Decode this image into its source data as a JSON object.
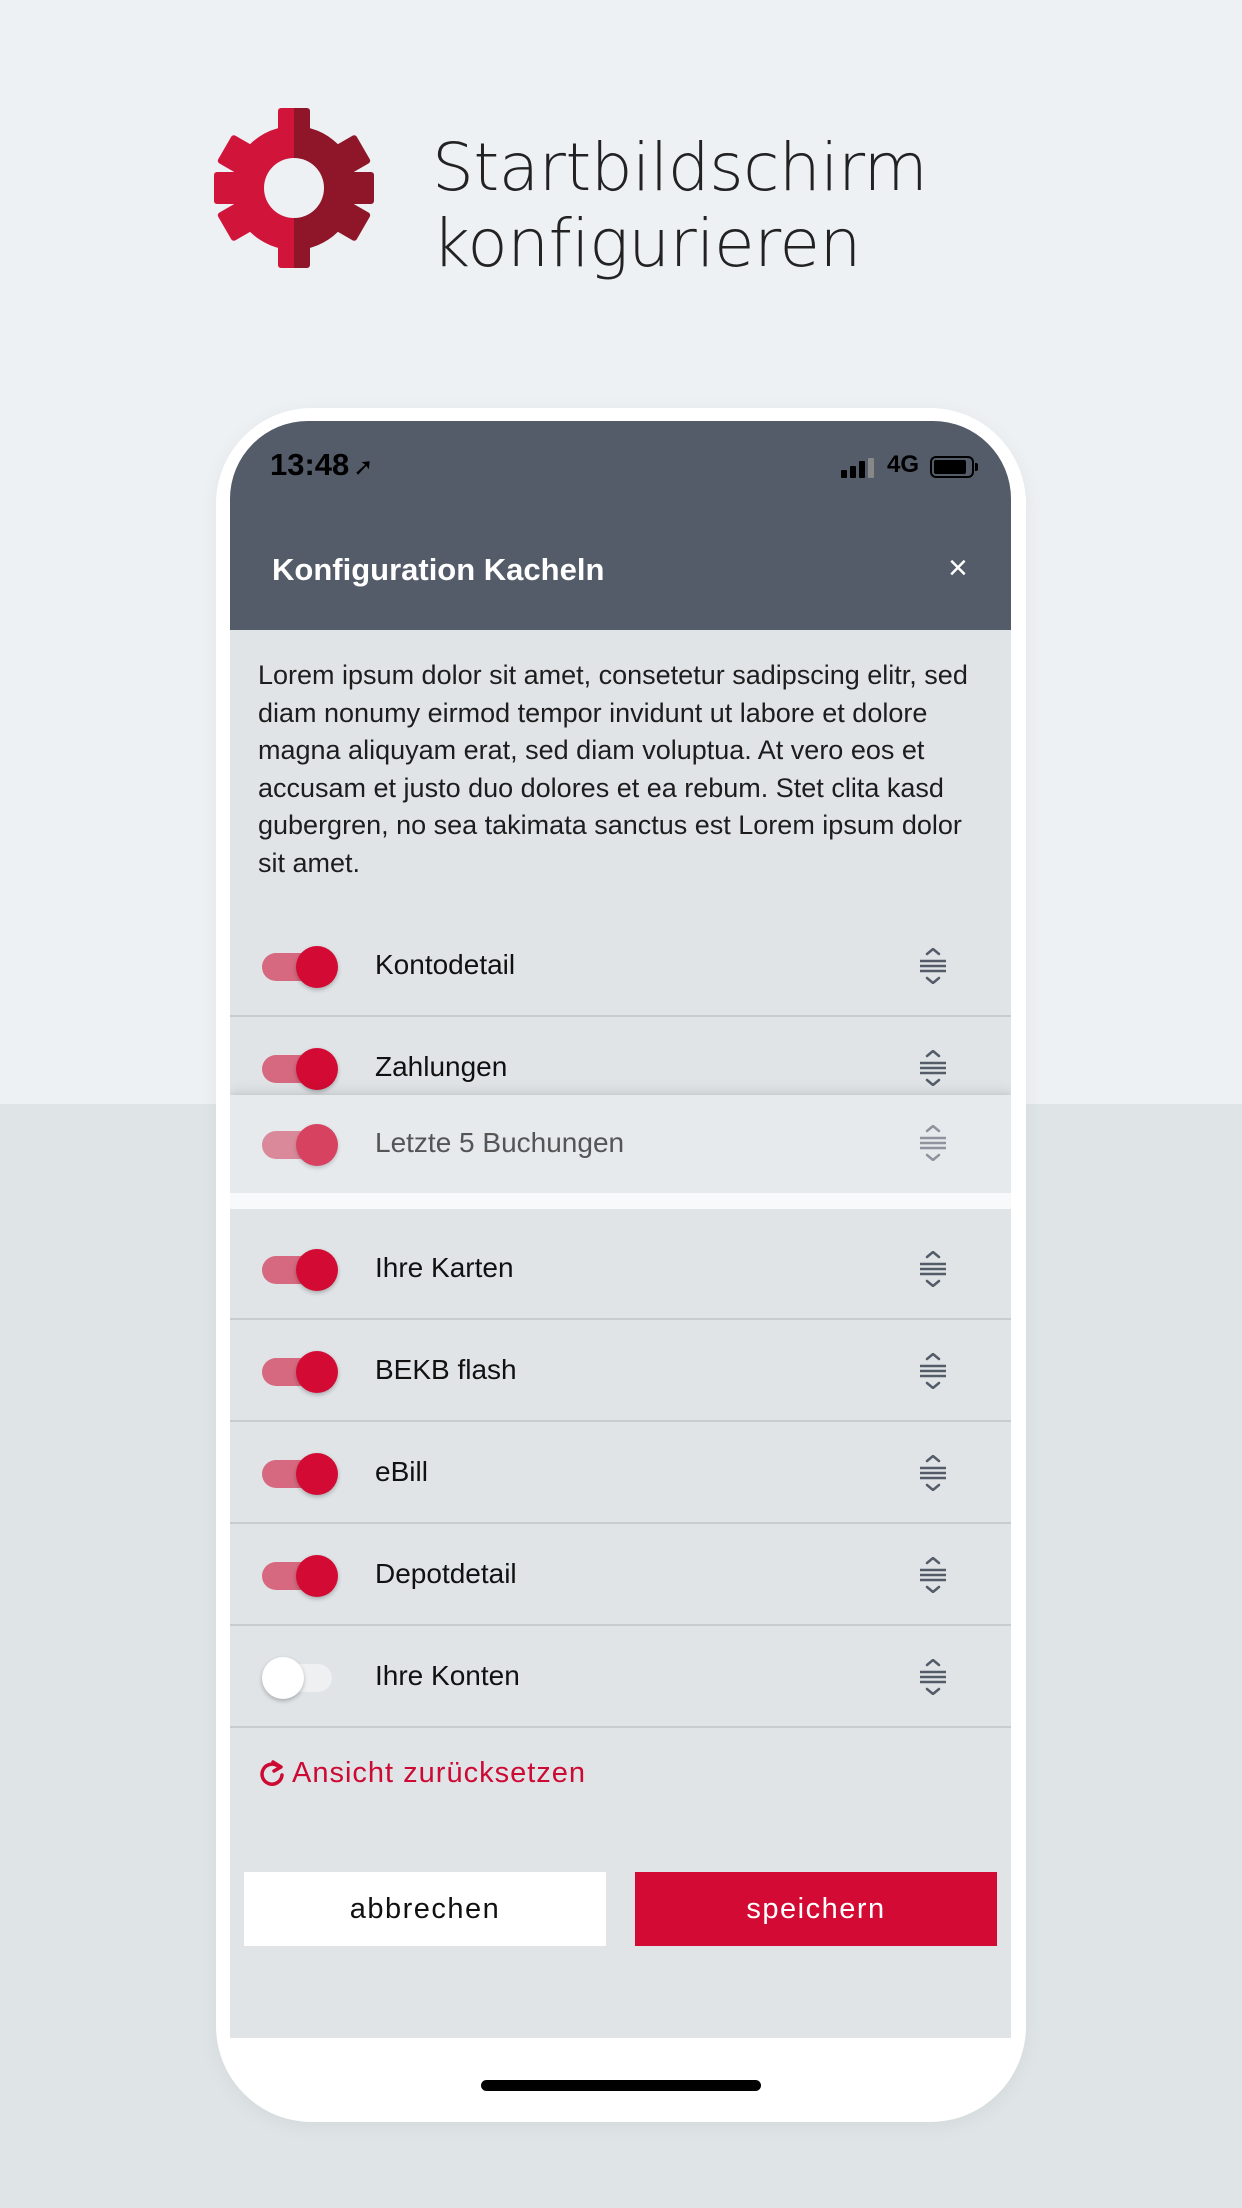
{
  "hero": {
    "title_line1": "Startbildschirm",
    "title_line2": "konfigurieren",
    "icon": "gear-icon",
    "accent": "#d30a33"
  },
  "status": {
    "time": "13:48",
    "network": "4G"
  },
  "header": {
    "title": "Konfiguration Kacheln",
    "close": "×"
  },
  "intro_text": "Lorem ipsum dolor sit amet, consetetur sadipscing elitr, sed diam nonumy eirmod tempor invidunt ut labore et dolore magna aliquyam erat, sed diam voluptua. At vero eos et accusam et justo duo dolores et ea rebum. Stet clita kasd gubergren, no sea takimata sanctus est Lorem ipsum dolor sit amet.",
  "tiles": [
    {
      "label": "Kontodetail",
      "enabled": true
    },
    {
      "label": "Zahlungen",
      "enabled": true
    },
    {
      "label": "Ihre Karten",
      "enabled": true
    },
    {
      "label": "BEKB flash",
      "enabled": true
    },
    {
      "label": "eBill",
      "enabled": true
    },
    {
      "label": "Depotdetail",
      "enabled": true
    },
    {
      "label": "Ihre Konten",
      "enabled": false
    }
  ],
  "dragging_tile": {
    "label": "Letzte 5 Buchungen",
    "enabled": true
  },
  "reset_label": "Ansicht zurücksetzen",
  "buttons": {
    "cancel": "abbrechen",
    "save": "speichern"
  }
}
